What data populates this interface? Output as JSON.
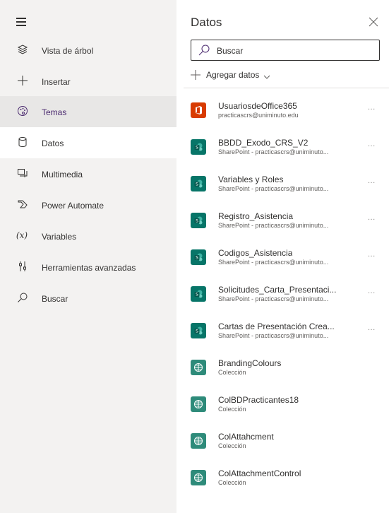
{
  "rail": {
    "items": [
      {
        "label": "Vista de árbol",
        "icon": "layers-icon"
      },
      {
        "label": "Insertar",
        "icon": "plus-icon"
      },
      {
        "label": "Temas",
        "icon": "palette-icon"
      },
      {
        "label": "Datos",
        "icon": "database-icon"
      },
      {
        "label": "Multimedia",
        "icon": "media-icon"
      },
      {
        "label": "Power Automate",
        "icon": "power-automate-icon"
      },
      {
        "label": "Variables",
        "icon": "variable-icon"
      },
      {
        "label": "Herramientas avanzadas",
        "icon": "tools-icon"
      },
      {
        "label": "Buscar",
        "icon": "search-icon"
      }
    ]
  },
  "panel": {
    "title": "Datos",
    "search_placeholder": "Buscar",
    "add_data_label": "Agregar datos",
    "more_label": "...",
    "sources": [
      {
        "name": "UsuariosdeOffice365",
        "sub": "practicascrs@uniminuto.edu",
        "type": "office",
        "more": true
      },
      {
        "name": "BBDD_Exodo_CRS_V2",
        "sub": "SharePoint - practicascrs@uniminuto...",
        "type": "sharepoint",
        "more": true
      },
      {
        "name": "Variables y Roles",
        "sub": "SharePoint - practicascrs@uniminuto...",
        "type": "sharepoint",
        "more": true
      },
      {
        "name": "Registro_Asistencia",
        "sub": "SharePoint - practicascrs@uniminuto...",
        "type": "sharepoint",
        "more": true
      },
      {
        "name": "Codigos_Asistencia",
        "sub": "SharePoint - practicascrs@uniminuto...",
        "type": "sharepoint",
        "more": true
      },
      {
        "name": "Solicitudes_Carta_Presentaci...",
        "sub": "SharePoint - practicascrs@uniminuto...",
        "type": "sharepoint",
        "more": true
      },
      {
        "name": "Cartas de Presentación Crea...",
        "sub": "SharePoint - practicascrs@uniminuto...",
        "type": "sharepoint",
        "more": true
      },
      {
        "name": "BrandingColours",
        "sub": "Colección",
        "type": "collection",
        "more": false
      },
      {
        "name": "ColBDPracticantes18",
        "sub": "Colección",
        "type": "collection",
        "more": false
      },
      {
        "name": "ColAttahcment",
        "sub": "Colección",
        "type": "collection",
        "more": false
      },
      {
        "name": "ColAttachmentControl",
        "sub": "Colección",
        "type": "collection",
        "more": false
      }
    ]
  },
  "colors": {
    "rail_bg": "#f3f2f1",
    "office": "#d83b01",
    "sharepoint": "#077568",
    "collection": "#2e8b7a",
    "theme_accent": "#4b2a6f"
  }
}
